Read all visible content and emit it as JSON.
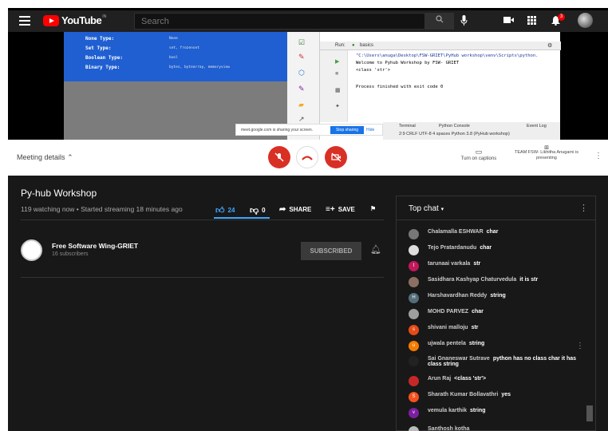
{
  "youtube": {
    "logo_text": "YouTube",
    "logo_sup": "IN",
    "search_placeholder": "Search",
    "notification_count": "3"
  },
  "screen_share": {
    "slide_rows": [
      {
        "label": "None Type:",
        "value": "None"
      },
      {
        "label": "Set Type:",
        "value": "set, frozenset"
      },
      {
        "label": "Boolean Type:",
        "value": "bool"
      },
      {
        "label": "Binary Type:",
        "value": "bytes, bytearray, memoryview"
      }
    ],
    "ide_tab_run": "Run:",
    "ide_tab_file": "basics",
    "ide_lines": [
      "\"C:\\Users\\anuga\\Desktop\\FSW-GRIET\\PyHub workshop\\venv\\Scripts\\python.",
      "Welcome to Pyhub Workshop by FSW- GRIET",
      "<class 'str'>",
      "",
      "Process finished with exit code 0"
    ],
    "sharing_text": "meet.google.com is sharing your screen.",
    "stop_sharing": "Stop sharing",
    "hide": "Hide",
    "terminal": "Terminal",
    "python_console": "Python Console",
    "event_log": "Event Log",
    "status_line": "2:9  CRLF  UTF-8  4 spaces  Python 3.8 (PyHub workshop)"
  },
  "meet": {
    "meeting_details": "Meeting details",
    "captions": "Turn on captions",
    "presenting": "TEAM FSW- Likhitha Anugarni is presenting"
  },
  "video": {
    "title": "Py-hub Workshop",
    "meta": "119 watching now • Started streaming 18 minutes ago",
    "likes": "24",
    "dislikes": "0",
    "share": "SHARE",
    "save": "SAVE"
  },
  "channel": {
    "name": "Free Software Wing-GRIET",
    "subscribers": "16 subscribers",
    "subscribed": "SUBSCRIBED"
  },
  "chat": {
    "title": "Top chat",
    "messages": [
      {
        "author": "Chalamalla ESHWAR",
        "text": "char",
        "color": "#777",
        "initial": ""
      },
      {
        "author": "Tejo Pratardanudu",
        "text": "char",
        "color": "#ddd",
        "initial": ""
      },
      {
        "author": "tarunaai varkala",
        "text": "str",
        "color": "#c2185b",
        "initial": "t"
      },
      {
        "author": "Sasidhara Kashyap Chaturvedula",
        "text": "it is str",
        "color": "#8d6e63",
        "initial": ""
      },
      {
        "author": "Harshavardhan Reddy",
        "text": "string",
        "color": "#546e7a",
        "initial": "H"
      },
      {
        "author": "MOHD PARVEZ",
        "text": "char",
        "color": "#9e9e9e",
        "initial": ""
      },
      {
        "author": "shivani malloju",
        "text": "str",
        "color": "#e64a19",
        "initial": "s"
      },
      {
        "author": "ujwala pentela",
        "text": "string",
        "color": "#f57c00",
        "initial": "u"
      },
      {
        "author": "Sai Gnaneswar Sutrave",
        "text": "python has no class char it has class string",
        "color": "#222",
        "initial": ""
      },
      {
        "author": "Arun Raj",
        "text": "<class 'str'>",
        "color": "#c62828",
        "initial": ""
      },
      {
        "author": "Sharath Kumar Bollavathri",
        "text": "yes",
        "color": "#f4511e",
        "initial": "S"
      },
      {
        "author": "vemula karthik",
        "text": "string",
        "color": "#7b1fa2",
        "initial": "v"
      },
      {
        "author": "Santhosh kotha",
        "text": "",
        "color": "#bbb",
        "initial": ""
      }
    ]
  }
}
